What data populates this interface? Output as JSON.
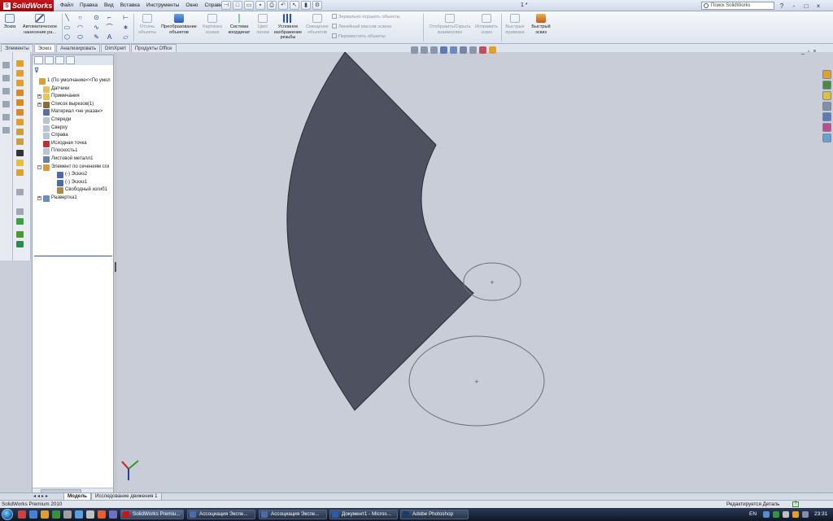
{
  "app": {
    "logo": "SolidWorks",
    "menu": [
      "Файл",
      "Правка",
      "Вид",
      "Вставка",
      "Инструменты",
      "Окно",
      "Справка"
    ],
    "doc_title": "1 *",
    "search_placeholder": "Поиск SolidWorks",
    "title_icons": [
      "?",
      "-",
      "□",
      "×"
    ]
  },
  "toolbar": {
    "sketch": "Эскиз",
    "auto_dim": "Автоматическое нанесение ра...",
    "trim": "Отсечь объекты",
    "convert": "Преобразование объектов",
    "sketch_picture": "Картинка эскиза",
    "coord_sys": "Система координат",
    "centerline": "Цвет линии",
    "cosmetic_thread": "Условное изображение резьбы",
    "offset": "Смещение объектов",
    "mirror": "Зеркально отразить объекты",
    "linear_pattern": "Линейный массив эскиза",
    "move": "Переместить объекты",
    "show_hide": "Отобразить/Скрыть взаимосвяз",
    "repair": "Исправить эскиз",
    "quick_snaps": "Быстрые привязки",
    "rapid_sketch": "Быстрый эскиз"
  },
  "tabs": [
    "Элементы",
    "Эскиз",
    "Анализировать",
    "DimXpert",
    "Продукты Office"
  ],
  "active_tab": "Эскиз",
  "tree": [
    {
      "label": "1  (По умолчанию<<По умол",
      "indent": 0,
      "pm": "",
      "color": "#d4a13a"
    },
    {
      "label": "Датчики",
      "indent": 1,
      "pm": "",
      "color": "#e0c060"
    },
    {
      "label": "Примечания",
      "indent": 1,
      "pm": "+",
      "color": "#e8c25a"
    },
    {
      "label": "Список вырезов(1)",
      "indent": 1,
      "pm": "+",
      "color": "#8c6a3c"
    },
    {
      "label": "Материал <не указан>",
      "indent": 1,
      "pm": "",
      "color": "#5a6fa8"
    },
    {
      "label": "Спереди",
      "indent": 1,
      "pm": "",
      "color": "#b8c4d8"
    },
    {
      "label": "Сверху",
      "indent": 1,
      "pm": "",
      "color": "#b8c4d8"
    },
    {
      "label": "Справа",
      "indent": 1,
      "pm": "",
      "color": "#b8c4d8"
    },
    {
      "label": "Исходная точка",
      "indent": 1,
      "pm": "",
      "color": "#c03030"
    },
    {
      "label": "Плоскость1",
      "indent": 1,
      "pm": "",
      "color": "#b8c4d8"
    },
    {
      "label": "Листовой металл1",
      "indent": 1,
      "pm": "",
      "color": "#6e7fa8"
    },
    {
      "label": "Элемент по сечениям сги",
      "indent": 1,
      "pm": "-",
      "color": "#d89a3a"
    },
    {
      "label": "(-) Эскиз2",
      "indent": 2,
      "pm": "",
      "color": "#4a6aa8"
    },
    {
      "label": "(-) Эскиз1",
      "indent": 2,
      "pm": "",
      "color": "#4a6aa8"
    },
    {
      "label": "Свободный изгиб1",
      "indent": 2,
      "pm": "",
      "color": "#a88a4a"
    },
    {
      "label": "Развертка1",
      "indent": 1,
      "pm": "+",
      "color": "#6a8ac8"
    }
  ],
  "model_tabs": [
    "Модель",
    "Исследование движения 1"
  ],
  "status": {
    "left": "SolidWorks Premium 2010",
    "right": "Редактируется Деталь",
    "help": "?"
  },
  "taskbar": {
    "items": [
      "SolidWorks Premiu...",
      "Ассоциация Экспе...",
      "Ассоциация Экспе...",
      "Документ1 - Micros...",
      "Adobe Photoshop"
    ],
    "lang": "EN",
    "clock": "23:31"
  },
  "colors": {
    "part_fill": "#4d5160",
    "background": "#c9cdd7",
    "sketch_ellipse": "#6c6f78"
  }
}
